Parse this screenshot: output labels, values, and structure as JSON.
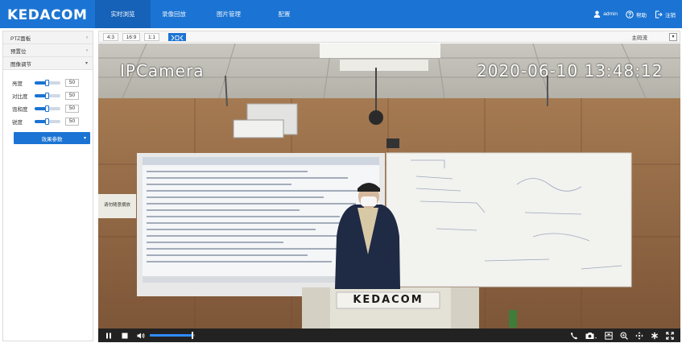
{
  "header": {
    "logo": "KEDACOM",
    "nav": [
      {
        "label": "实时浏览",
        "active": true
      },
      {
        "label": "录像回放",
        "active": false
      },
      {
        "label": "图片管理",
        "active": false
      },
      {
        "label": "配置",
        "active": false
      }
    ],
    "user": {
      "name": "admin",
      "help_label": "帮助",
      "logout_label": "注销"
    }
  },
  "left_panel": {
    "sections": [
      {
        "label": "PTZ面板",
        "arrow": "‹"
      },
      {
        "label": "预置位",
        "arrow": "‹"
      },
      {
        "label": "图像调节",
        "arrow": "▾"
      }
    ],
    "image_adjust": [
      {
        "label": "亮度",
        "value": "50"
      },
      {
        "label": "对比度",
        "value": "50"
      },
      {
        "label": "饱和度",
        "value": "50"
      },
      {
        "label": "锐度",
        "value": "50"
      }
    ],
    "effect_button": "效果参数",
    "effect_arrow": "▾"
  },
  "toolbar": {
    "ratios": [
      "4:3",
      "16:9",
      "1:1"
    ],
    "stream_label": "主码流",
    "stream_arrow": "▾"
  },
  "video": {
    "osd_name": "IPCamera",
    "osd_datetime": "2020-06-10 13:48:12",
    "podium_text": "KEDACOM",
    "poster_text": "请勿随意摘放"
  },
  "playbar": {
    "volume_level": 0.95
  },
  "colors": {
    "brand_blue": "#1b74d3",
    "nav_active": "#1562b8",
    "playbar_bg": "#222222",
    "volume_fill": "#2e8cff"
  }
}
